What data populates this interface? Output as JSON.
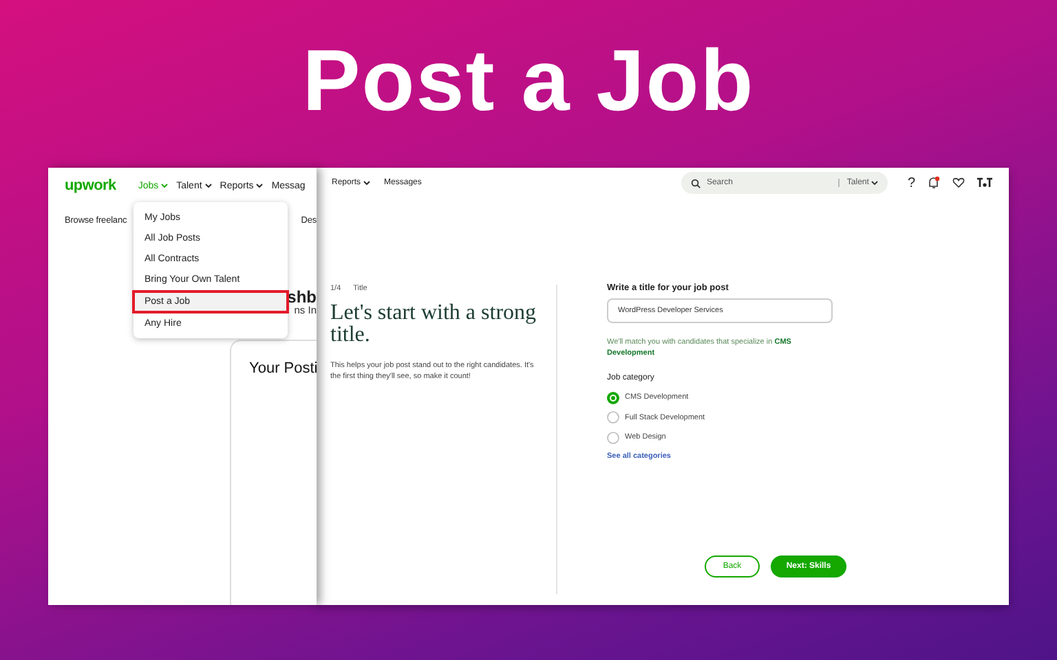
{
  "heading": "Post a Job",
  "left_screen": {
    "logo": "upwork",
    "nav": [
      {
        "label": "Jobs",
        "has_menu": true,
        "selected": true
      },
      {
        "label": "Talent",
        "has_menu": true,
        "selected": false
      },
      {
        "label": "Reports",
        "has_menu": true,
        "selected": false
      },
      {
        "label": "Messag",
        "has_menu": false,
        "selected": false
      }
    ],
    "subnav_left": "Browse freelanc",
    "subnav_right": "Des",
    "fragments": [
      "shb",
      "ns In"
    ],
    "card_title": "Your Posti",
    "menu": [
      {
        "label": "My Jobs",
        "highlighted": false
      },
      {
        "label": "All Job Posts",
        "highlighted": false
      },
      {
        "label": "All Contracts",
        "highlighted": false
      },
      {
        "label": "Bring Your Own Talent",
        "highlighted": false
      },
      {
        "label": "Post a Job",
        "highlighted": true
      },
      {
        "label": "Any Hire",
        "highlighted": false
      }
    ]
  },
  "right_screen": {
    "nav": [
      {
        "label": "Reports",
        "has_menu": true
      },
      {
        "label": "Messages",
        "has_menu": false
      }
    ],
    "search": {
      "placeholder": "Search",
      "scope": "Talent"
    },
    "help": "?",
    "has_notification": true,
    "step": "1/4",
    "step_name": "Title",
    "headline": "Let's start with a strong title.",
    "description": "This helps your job post stand out to the right candidates. It's the first thing they'll see, so make it count!",
    "field_label": "Write a title for your job post",
    "field_value": "WordPress Developer Services",
    "hint": "We'll match you with candidates that specialize in **CMS Development**",
    "category_label": "Job category",
    "categories": [
      {
        "label": "CMS Development",
        "selected": true
      },
      {
        "label": "Full Stack Development",
        "selected": false
      },
      {
        "label": "Web Design",
        "selected": false
      }
    ],
    "link": "See all categories",
    "buttons": [
      {
        "label": "Back",
        "kind": "secondary"
      },
      {
        "label": "Next: Skills",
        "kind": "primary"
      }
    ]
  }
}
